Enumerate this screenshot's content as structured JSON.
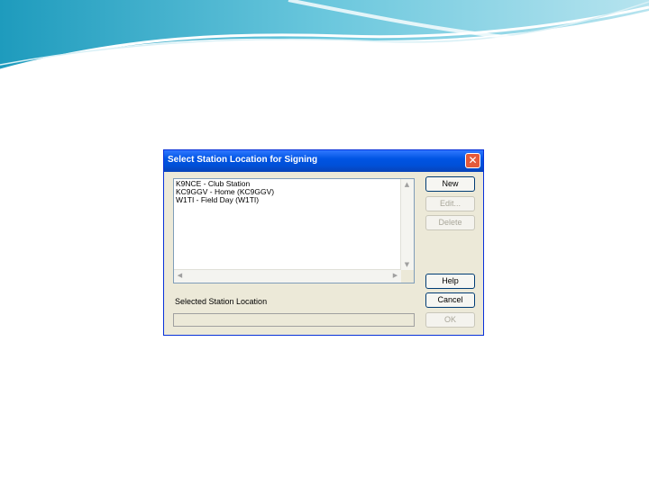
{
  "dialog": {
    "title": "Select Station Location for Signing",
    "close_glyph": "✕",
    "station_list": [
      "K9NCE - Club Station",
      "KC9GGV - Home (KC9GGV)",
      "W1TI - Field Day (W1TI)"
    ],
    "selected_label": "Selected Station Location",
    "selected_value": "",
    "buttons": {
      "new": "New",
      "edit": "Edit...",
      "delete": "Delete",
      "help": "Help",
      "cancel": "Cancel",
      "ok": "OK"
    },
    "scroll_arrows": {
      "up": "▲",
      "down": "▼",
      "left": "◀",
      "right": "▶"
    }
  },
  "icons": [
    "close-icon",
    "scroll-up-icon",
    "scroll-down-icon",
    "scroll-left-icon",
    "scroll-right-icon"
  ],
  "colors": {
    "titlebar": "#0054e3",
    "dialog_face": "#ece9d8",
    "close_button": "#e35a3a",
    "decor_teal": "#5ab8d2"
  }
}
